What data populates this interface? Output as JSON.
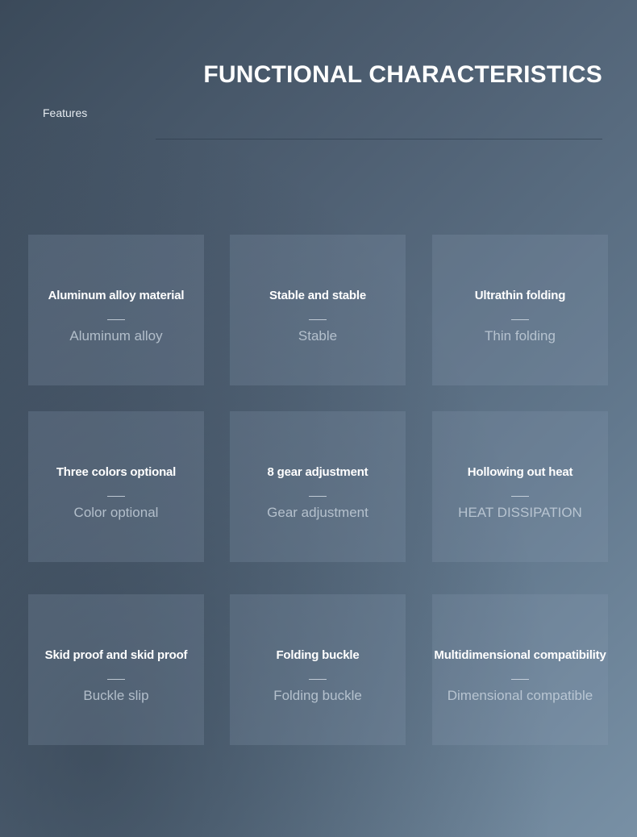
{
  "header": {
    "title": "FUNCTIONAL CHARACTERISTICS",
    "subtitle": "Features"
  },
  "features": [
    {
      "title": "Aluminum alloy material",
      "subtitle": "Aluminum alloy"
    },
    {
      "title": "Stable and stable",
      "subtitle": "Stable"
    },
    {
      "title": "Ultrathin folding",
      "subtitle": "Thin folding"
    },
    {
      "title": "Three colors optional",
      "subtitle": "Color optional"
    },
    {
      "title": "8 gear adjustment",
      "subtitle": "Gear adjustment"
    },
    {
      "title": "Hollowing out heat",
      "subtitle": "HEAT DISSIPATION"
    },
    {
      "title": "Skid proof and skid proof",
      "subtitle": "Buckle slip"
    },
    {
      "title": "Folding buckle",
      "subtitle": "Folding buckle"
    },
    {
      "title": "Multidimensional compatibility",
      "subtitle": "Dimensional compatible"
    }
  ]
}
